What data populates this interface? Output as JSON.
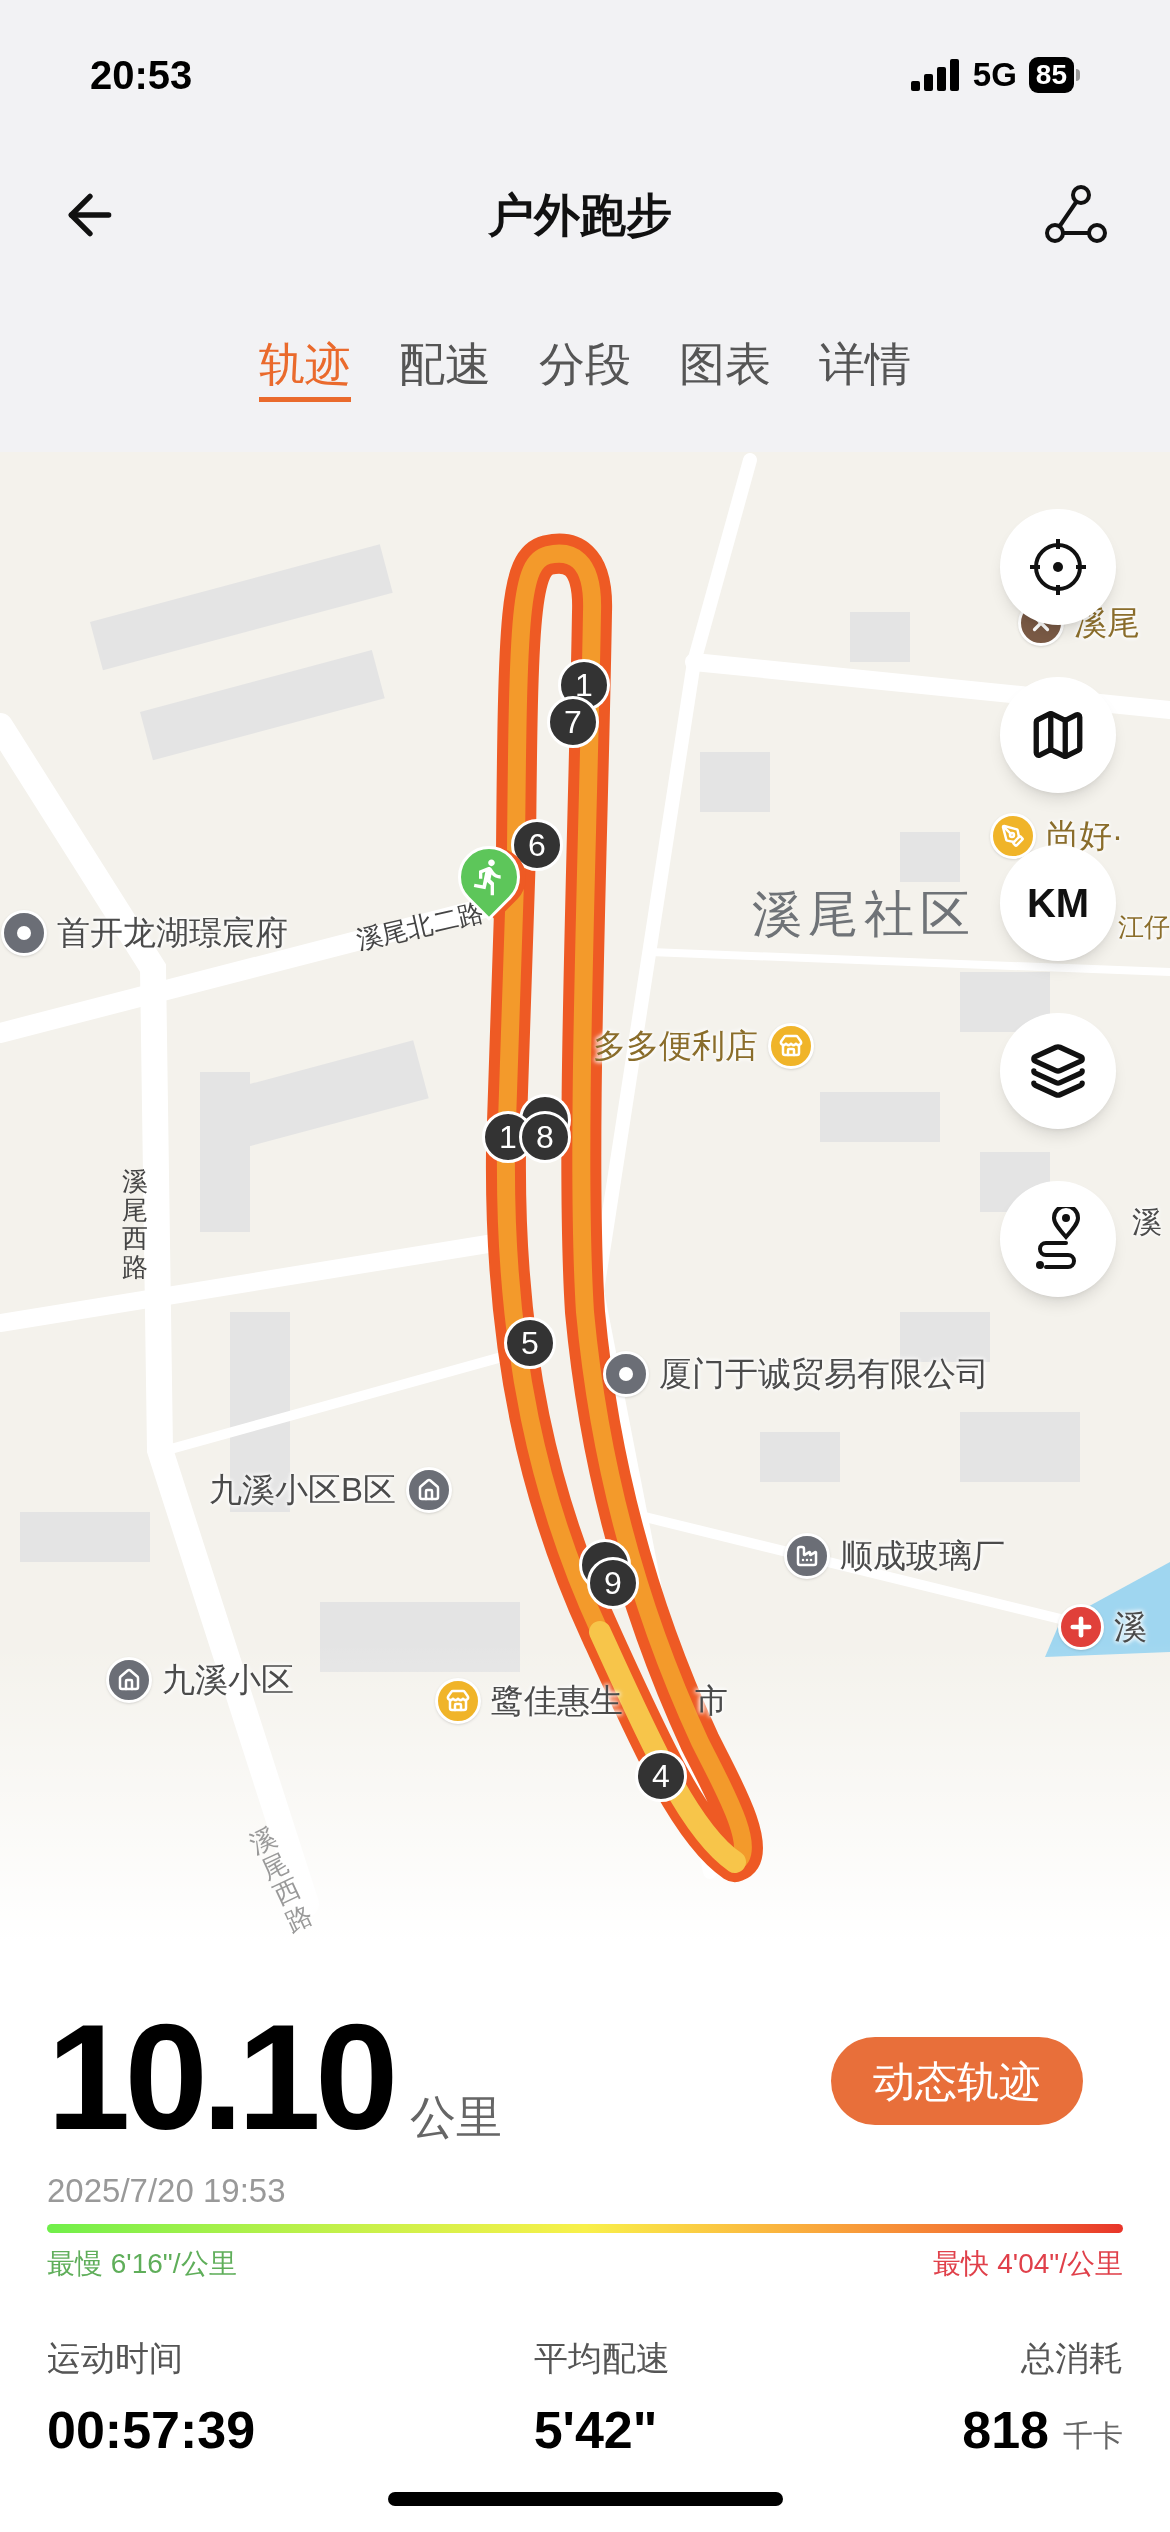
{
  "status_bar": {
    "time": "20:53",
    "network": "5G",
    "battery": "85"
  },
  "header": {
    "title": "户外跑步"
  },
  "tabs": [
    {
      "label": "轨迹",
      "selected": true
    },
    {
      "label": "配速",
      "selected": false
    },
    {
      "label": "分段",
      "selected": false
    },
    {
      "label": "图表",
      "selected": false
    },
    {
      "label": "详情",
      "selected": false
    }
  ],
  "map": {
    "area": "溪尾社区",
    "roads": [
      "溪尾北二路",
      "溪尾西路",
      "溪尾西路"
    ],
    "pois": [
      {
        "text": "首开龙湖璟宸府"
      },
      {
        "text": "溪尾"
      },
      {
        "text": "尚好·"
      },
      {
        "text": "多多便利店"
      },
      {
        "text": "江仔"
      },
      {
        "text": "厦门于诚贸易有限公司"
      },
      {
        "text": "九溪小区B区"
      },
      {
        "text": "顺成玻璃厂"
      },
      {
        "text": "九溪小区"
      },
      {
        "text": "鹭佳惠生"
      },
      {
        "text": "市"
      },
      {
        "text": "溪"
      },
      {
        "text": "溪"
      }
    ],
    "km_markers": [
      "1",
      "7",
      "6",
      "1",
      "8",
      "5",
      "9",
      "4"
    ],
    "km_button": "KM"
  },
  "summary": {
    "distance": "10.10",
    "distance_unit": "公里",
    "replay_button": "动态轨迹",
    "date": "2025/7/20 19:53",
    "slowest": "最慢 6'16\"/公里",
    "fastest": "最快 4'04\"/公里",
    "stats": [
      {
        "label": "运动时间",
        "value": "00:57:39"
      },
      {
        "label": "平均配速",
        "value": "5'42\""
      },
      {
        "label": "总消耗",
        "value": "818",
        "unit": "千卡"
      }
    ]
  }
}
